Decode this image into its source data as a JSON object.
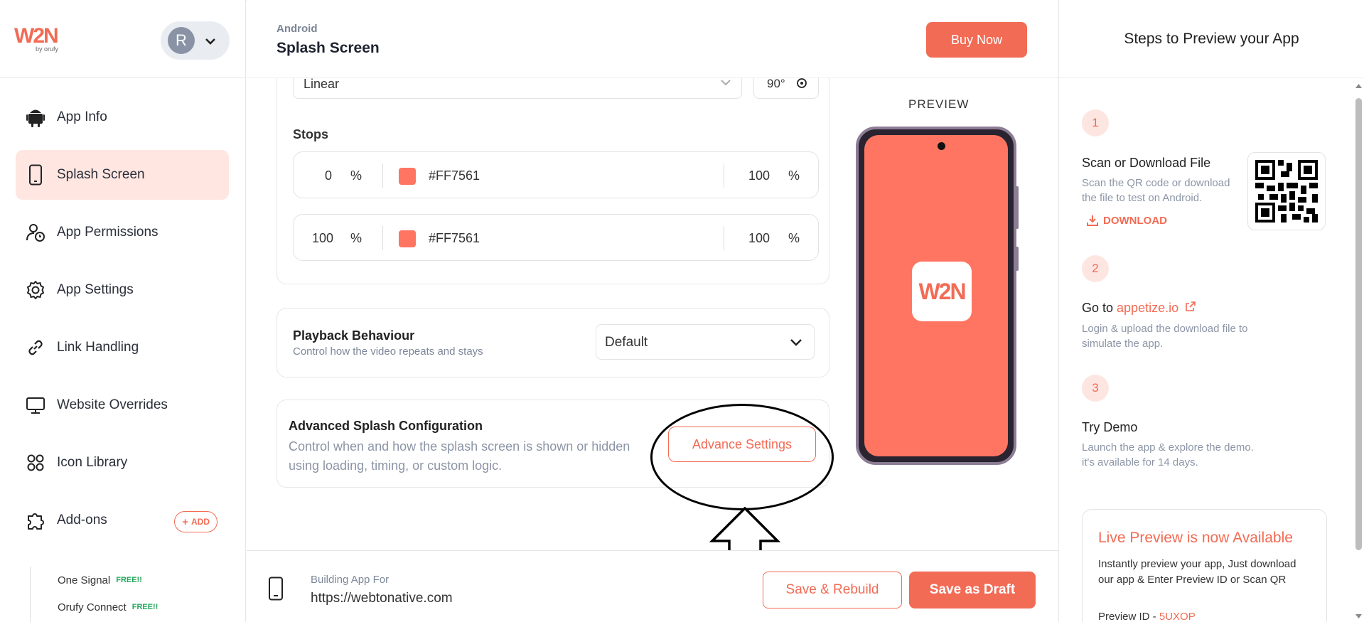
{
  "app": {
    "logo_text": "W2N",
    "logo_by": "by orufy"
  },
  "user": {
    "avatar_letter": "R"
  },
  "sidebar": {
    "items": [
      {
        "label": "App Info",
        "icon": "android-icon"
      },
      {
        "label": "Splash Screen",
        "icon": "phone-icon",
        "active": true
      },
      {
        "label": "App Permissions",
        "icon": "user-clock-icon"
      },
      {
        "label": "App Settings",
        "icon": "gear-icon"
      },
      {
        "label": "Link Handling",
        "icon": "link-icon"
      },
      {
        "label": "Website Overrides",
        "icon": "monitor-icon"
      },
      {
        "label": "Icon Library",
        "icon": "grid-icon"
      },
      {
        "label": "Add-ons",
        "icon": "puzzle-icon"
      }
    ],
    "add_label": "ADD",
    "sub_items": [
      {
        "label": "One Signal",
        "badge": "FREE!!"
      },
      {
        "label": "Orufy Connect",
        "badge": "FREE!!"
      }
    ]
  },
  "header": {
    "breadcrumb": "Android",
    "title": "Splash Screen",
    "buy_label": "Buy Now"
  },
  "gradient": {
    "type_value": "Linear",
    "angle_value": "90°",
    "stops_label": "Stops",
    "stops": [
      {
        "position": "0",
        "unit": "%",
        "color": "#FF7561",
        "opacity": "100",
        "opacity_unit": "%"
      },
      {
        "position": "100",
        "unit": "%",
        "color": "#FF7561",
        "opacity": "100",
        "opacity_unit": "%"
      }
    ]
  },
  "playback": {
    "title": "Playback Behaviour",
    "subtitle": "Control how the video repeats and stays",
    "value": "Default"
  },
  "advanced": {
    "title": "Advanced Splash Configuration",
    "subtitle": "Control when and how the splash screen is shown or hidden using loading, timing, or custom logic.",
    "button_label": "Advance Settings"
  },
  "preview": {
    "label": "PREVIEW",
    "screen_color": "#FF7561"
  },
  "bottom": {
    "building_for_label": "Building App For",
    "url": "https://webtonative.com",
    "rebuild_label": "Save & Rebuild",
    "draft_label": "Save as Draft"
  },
  "right_panel": {
    "title": "Steps to Preview your App",
    "steps": [
      {
        "num": "1",
        "title": "Scan or Download File",
        "subtitle": "Scan the QR code or download the file to test on Android.",
        "action": "DOWNLOAD"
      },
      {
        "num": "2",
        "title_prefix": "Go to ",
        "title_link": "appetize.io",
        "subtitle": "Login & upload the download file to simulate the app."
      },
      {
        "num": "3",
        "title": "Try Demo",
        "subtitle": "Launch the app & explore the demo. it's available for 14 days."
      }
    ],
    "live": {
      "title": "Live Preview is now Available",
      "subtitle": "Instantly preview your app, Just download our app & Enter Preview ID or Scan QR",
      "preview_id_label": "Preview ID - ",
      "preview_id": "5UXOP"
    }
  },
  "colors": {
    "accent": "#F26B55",
    "active_bg": "#FFE6E1"
  }
}
